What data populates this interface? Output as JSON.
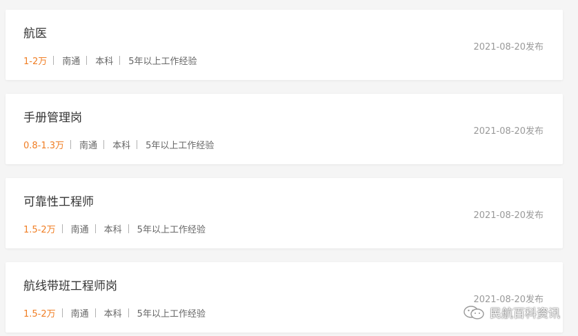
{
  "jobs": [
    {
      "title": "航医",
      "salary": "1-2万",
      "location": "南通",
      "education": "本科",
      "experience": "5年以上工作经验",
      "date": "2021-08-20发布"
    },
    {
      "title": "手册管理岗",
      "salary": "0.8-1.3万",
      "location": "南通",
      "education": "本科",
      "experience": "5年以上工作经验",
      "date": "2021-08-20发布"
    },
    {
      "title": "可靠性工程师",
      "salary": "1.5-2万",
      "location": "南通",
      "education": "本科",
      "experience": "5年以上工作经验",
      "date": "2021-08-20发布"
    },
    {
      "title": "航线带班工程师岗",
      "salary": "1.5-2万",
      "location": "南通",
      "education": "本科",
      "experience": "5年以上工作经验",
      "date": "2021-08-20发布"
    }
  ],
  "watermark": {
    "text": "民航百科资讯",
    "icon": "wechat-icon"
  },
  "colors": {
    "salary": "#f07d23",
    "title": "#333333",
    "meta": "#666666",
    "date": "#999999"
  }
}
